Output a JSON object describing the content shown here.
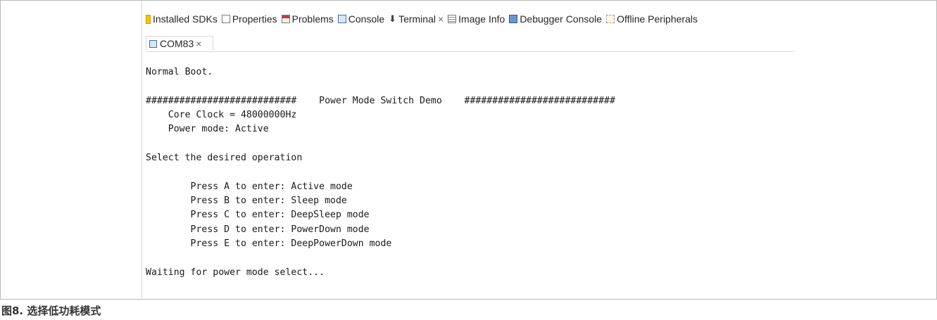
{
  "view_tabs": [
    {
      "label": "Installed SDKs",
      "icon": "sdk-icon"
    },
    {
      "label": "Properties",
      "icon": "properties-icon"
    },
    {
      "label": "Problems",
      "icon": "problems-icon"
    },
    {
      "label": "Console",
      "icon": "console-icon"
    },
    {
      "label": "Terminal",
      "icon": "terminal-icon",
      "close": "×"
    },
    {
      "label": "Image Info",
      "icon": "image-info-icon"
    },
    {
      "label": "Debugger Console",
      "icon": "debugger-console-icon"
    },
    {
      "label": "Offline Peripherals",
      "icon": "offline-peripherals-icon"
    }
  ],
  "terminal_tab": {
    "label": "COM83",
    "close": "×",
    "icon": "com-port-icon"
  },
  "console_text": "Normal Boot.\n\n###########################    Power Mode Switch Demo    ###########################\n    Core Clock = 48000000Hz\n    Power mode: Active\n\nSelect the desired operation\n\n        Press A to enter: Active mode\n        Press B to enter: Sleep mode\n        Press C to enter: DeepSleep mode\n        Press D to enter: PowerDown mode\n        Press E to enter: DeepPowerDown mode\n\nWaiting for power mode select...",
  "caption": "图8. 选择低功耗模式"
}
